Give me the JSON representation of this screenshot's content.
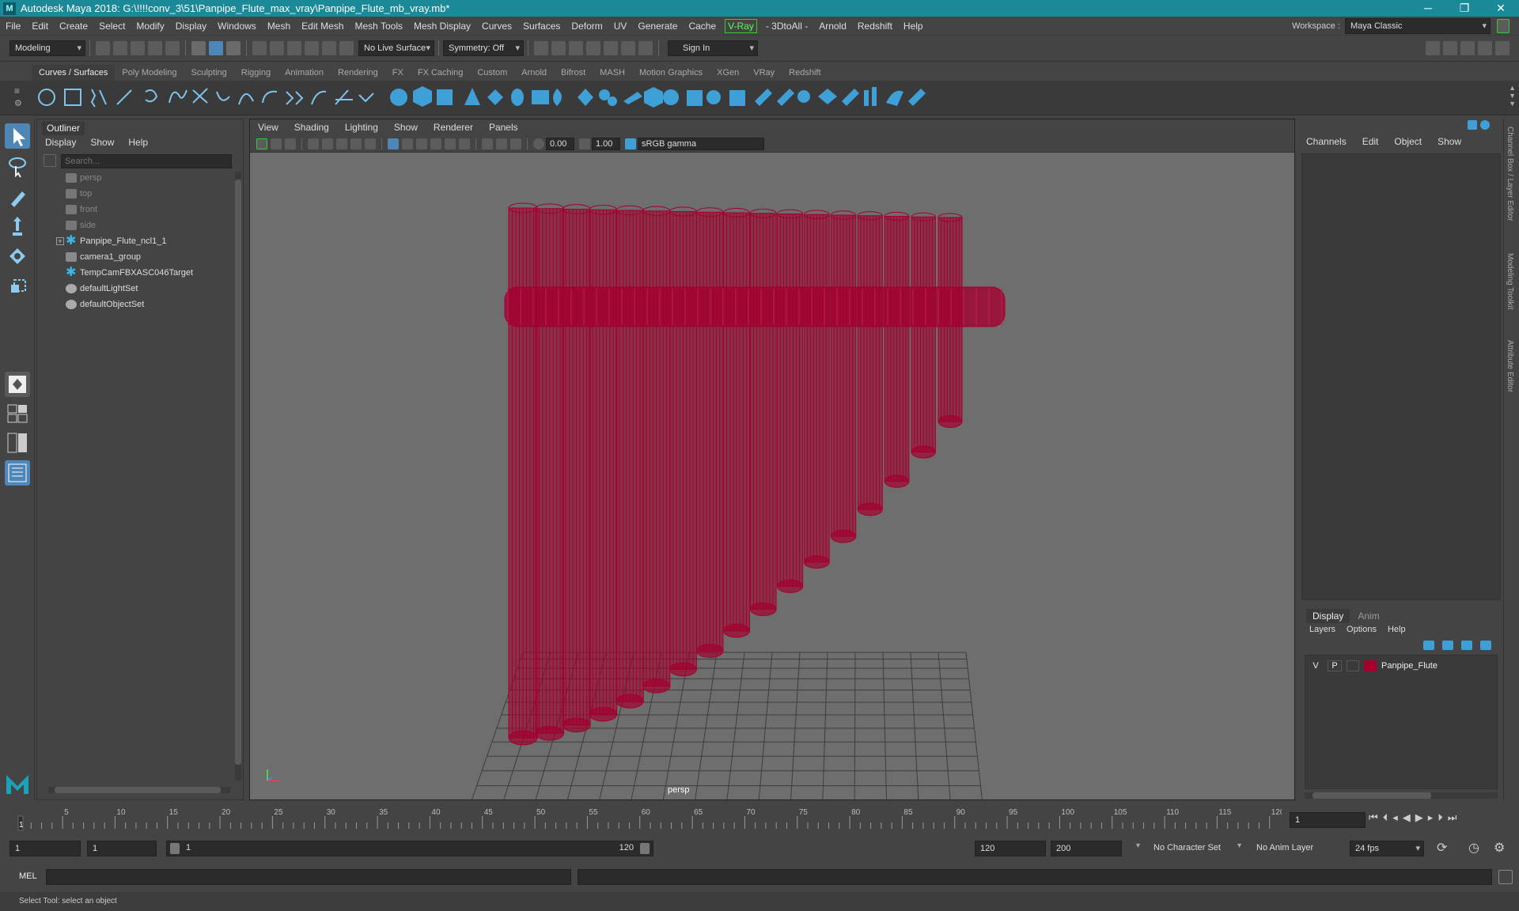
{
  "titlebar": {
    "title": "Autodesk Maya 2018: G:\\!!!!conv_3\\51\\Panpipe_Flute_max_vray\\Panpipe_Flute_mb_vray.mb*",
    "minimize_glyph": "─",
    "maximize_glyph": "❐",
    "close_glyph": "✕"
  },
  "menubar": {
    "items": [
      "File",
      "Edit",
      "Create",
      "Select",
      "Modify",
      "Display",
      "Windows",
      "Mesh",
      "Edit Mesh",
      "Mesh Tools",
      "Mesh Display",
      "Curves",
      "Surfaces",
      "Deform",
      "UV",
      "Generate",
      "Cache",
      "V-Ray",
      "- 3DtoAll -",
      "Arnold",
      "Redshift",
      "Help"
    ],
    "workspace_label": "Workspace :",
    "workspace_value": "Maya Classic"
  },
  "statusline": {
    "mode": "Modeling",
    "live_surface": "No Live Surface",
    "symmetry": "Symmetry: Off",
    "sign_in": "Sign In"
  },
  "shelf": {
    "tabs": [
      "Curves / Surfaces",
      "Poly Modeling",
      "Sculpting",
      "Rigging",
      "Animation",
      "Rendering",
      "FX",
      "FX Caching",
      "Custom",
      "Arnold",
      "Bifrost",
      "MASH",
      "Motion Graphics",
      "XGen",
      "VRay",
      "Redshift"
    ],
    "active_tab": "Curves / Surfaces",
    "accent_color": "#3fa0d8"
  },
  "outliner": {
    "title": "Outliner",
    "menu": [
      "Display",
      "Show",
      "Help"
    ],
    "search_placeholder": "Search...",
    "items": [
      {
        "label": "persp",
        "icon": "camera-icon",
        "dim": true
      },
      {
        "label": "top",
        "icon": "camera-icon",
        "dim": true
      },
      {
        "label": "front",
        "icon": "camera-icon",
        "dim": true
      },
      {
        "label": "side",
        "icon": "camera-icon",
        "dim": true
      },
      {
        "label": "Panpipe_Flute_ncl1_1",
        "icon": "locator-icon",
        "dim": false,
        "expandable": true
      },
      {
        "label": "camera1_group",
        "icon": "group-icon",
        "dim": false
      },
      {
        "label": "TempCamFBXASC046Target",
        "icon": "locator-icon",
        "dim": false
      },
      {
        "label": "defaultLightSet",
        "icon": "set-icon",
        "dim": false
      },
      {
        "label": "defaultObjectSet",
        "icon": "set-icon",
        "dim": false
      }
    ]
  },
  "viewport": {
    "menu": [
      "View",
      "Shading",
      "Lighting",
      "Show",
      "Renderer",
      "Panels"
    ],
    "exposure": "0.00",
    "gamma": "1.00",
    "color_space": "sRGB gamma",
    "camera_label": "persp",
    "wire_color": "#a3002e"
  },
  "channelbox": {
    "menu": [
      "Channels",
      "Edit",
      "Object",
      "Show"
    ]
  },
  "layers": {
    "tabs": [
      "Display",
      "Anim"
    ],
    "active_tab": "Display",
    "menu": [
      "Layers",
      "Options",
      "Help"
    ],
    "rows": [
      {
        "v": "V",
        "p": "P",
        "name": "Panpipe_Flute",
        "color": "#a3002e"
      }
    ]
  },
  "side_tabs": [
    "Channel Box / Layer Editor",
    "Modeling Toolkit",
    "Attribute Editor"
  ],
  "timeline": {
    "ticks": [
      "5",
      "10",
      "15",
      "20",
      "25",
      "30",
      "35",
      "40",
      "45",
      "50",
      "55",
      "60",
      "65",
      "70",
      "75",
      "80",
      "85",
      "90",
      "95",
      "100",
      "105",
      "110",
      "115",
      "120"
    ],
    "first_tick": "1",
    "current_frame": "1"
  },
  "range": {
    "start": "1",
    "playback_start": "1",
    "slider_start": "1",
    "slider_end": "120",
    "playback_end": "120",
    "end": "200",
    "character_set": "No Character Set",
    "anim_layer": "No Anim Layer",
    "fps": "24 fps"
  },
  "cmdline": {
    "label": "MEL"
  },
  "helpline": {
    "text": "Select Tool: select an object"
  }
}
